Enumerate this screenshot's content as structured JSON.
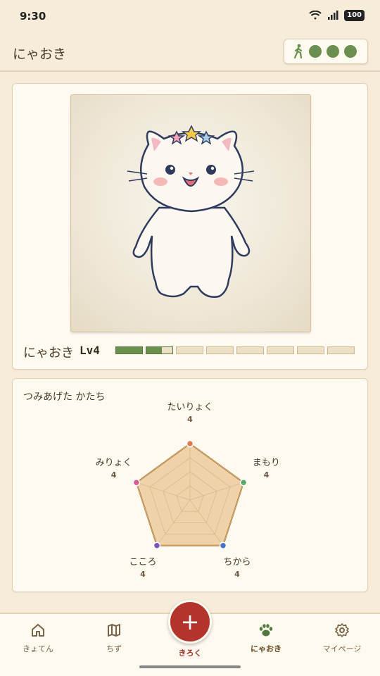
{
  "status": {
    "time": "9:30",
    "battery": "100"
  },
  "header": {
    "title": "にゃおき",
    "steps_icon": "walking-person-icon",
    "step_dots": 3,
    "accent": "#6b8f4e"
  },
  "pet": {
    "name": "にゃおき",
    "level_label": "Lv4",
    "xp_segments_total": 8,
    "xp_progress_segments": 1.6,
    "portrait": "white-cat-with-star-crown"
  },
  "stats": {
    "title": "つみあげた かたち",
    "items": [
      {
        "label": "たいりょく",
        "value": "4",
        "color": "#e07a55"
      },
      {
        "label": "まもり",
        "value": "4",
        "color": "#5aa86a"
      },
      {
        "label": "ちから",
        "value": "4",
        "color": "#4a73c6"
      },
      {
        "label": "こころ",
        "value": "4",
        "color": "#7a55b5"
      },
      {
        "label": "みりょく",
        "value": "4",
        "color": "#d95c8e"
      }
    ],
    "max": 4,
    "fill": "#efd2aa",
    "stroke": "#a9732b"
  },
  "nav": {
    "items": [
      {
        "label": "きょてん",
        "icon": "home-icon"
      },
      {
        "label": "ちず",
        "icon": "map-icon"
      },
      {
        "label": "きろく",
        "icon": "plus-icon"
      },
      {
        "label": "にゃおき",
        "icon": "paw-icon"
      },
      {
        "label": "マイページ",
        "icon": "gear-icon"
      }
    ],
    "active": "にゃおき"
  }
}
